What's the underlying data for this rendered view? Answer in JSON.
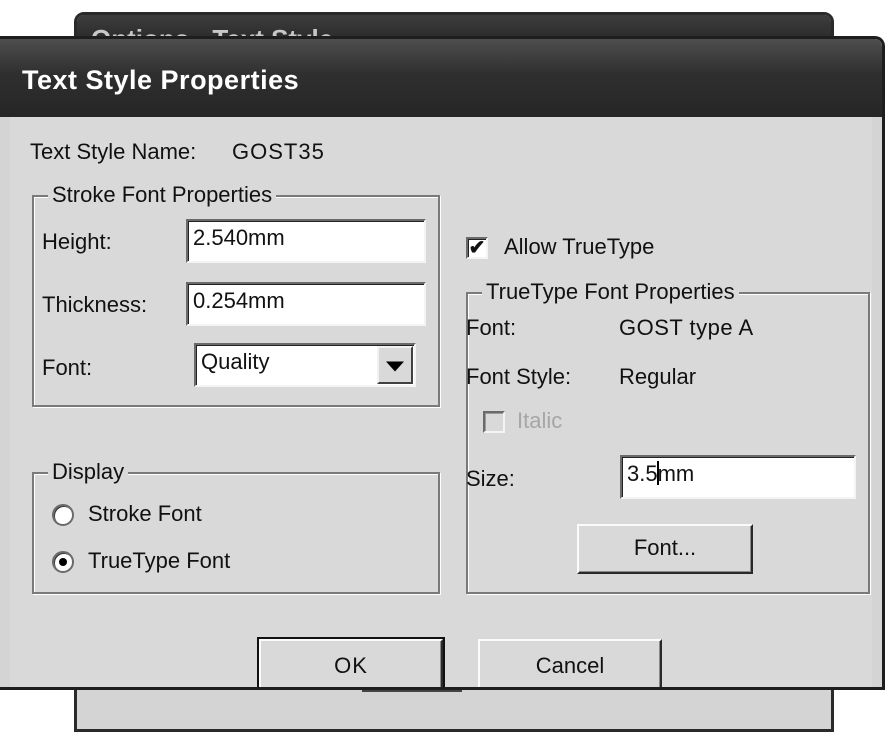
{
  "background_window": {
    "title": "Options - Text Style"
  },
  "dialog": {
    "title": "Text Style Properties",
    "text_style_name_label": "Text Style Name:",
    "text_style_name_value": "GOST35"
  },
  "stroke_font": {
    "legend": "Stroke Font Properties",
    "height_label": "Height:",
    "height_value": "2.540mm",
    "thickness_label": "Thickness:",
    "thickness_value": "0.254mm",
    "font_label": "Font:",
    "font_value": "Quality"
  },
  "display": {
    "legend": "Display",
    "options": [
      "Stroke Font",
      "TrueType Font"
    ],
    "selected": "TrueType Font"
  },
  "allow_truetype": {
    "label": "Allow TrueType",
    "checked": true
  },
  "truetype": {
    "legend": "TrueType Font Properties",
    "font_label": "Font:",
    "font_value": "GOST type A",
    "style_label": "Font Style:",
    "style_value": "Regular",
    "italic_label": "Italic",
    "italic_checked": false,
    "italic_enabled": false,
    "size_label": "Size:",
    "size_value_before_caret": "3.5",
    "size_value_after_caret": "mm",
    "font_button": "Font..."
  },
  "buttons": {
    "ok": "OK",
    "cancel": "Cancel"
  },
  "icons": {
    "checkmark": "✔",
    "dropdown": "chevron-down-icon"
  }
}
